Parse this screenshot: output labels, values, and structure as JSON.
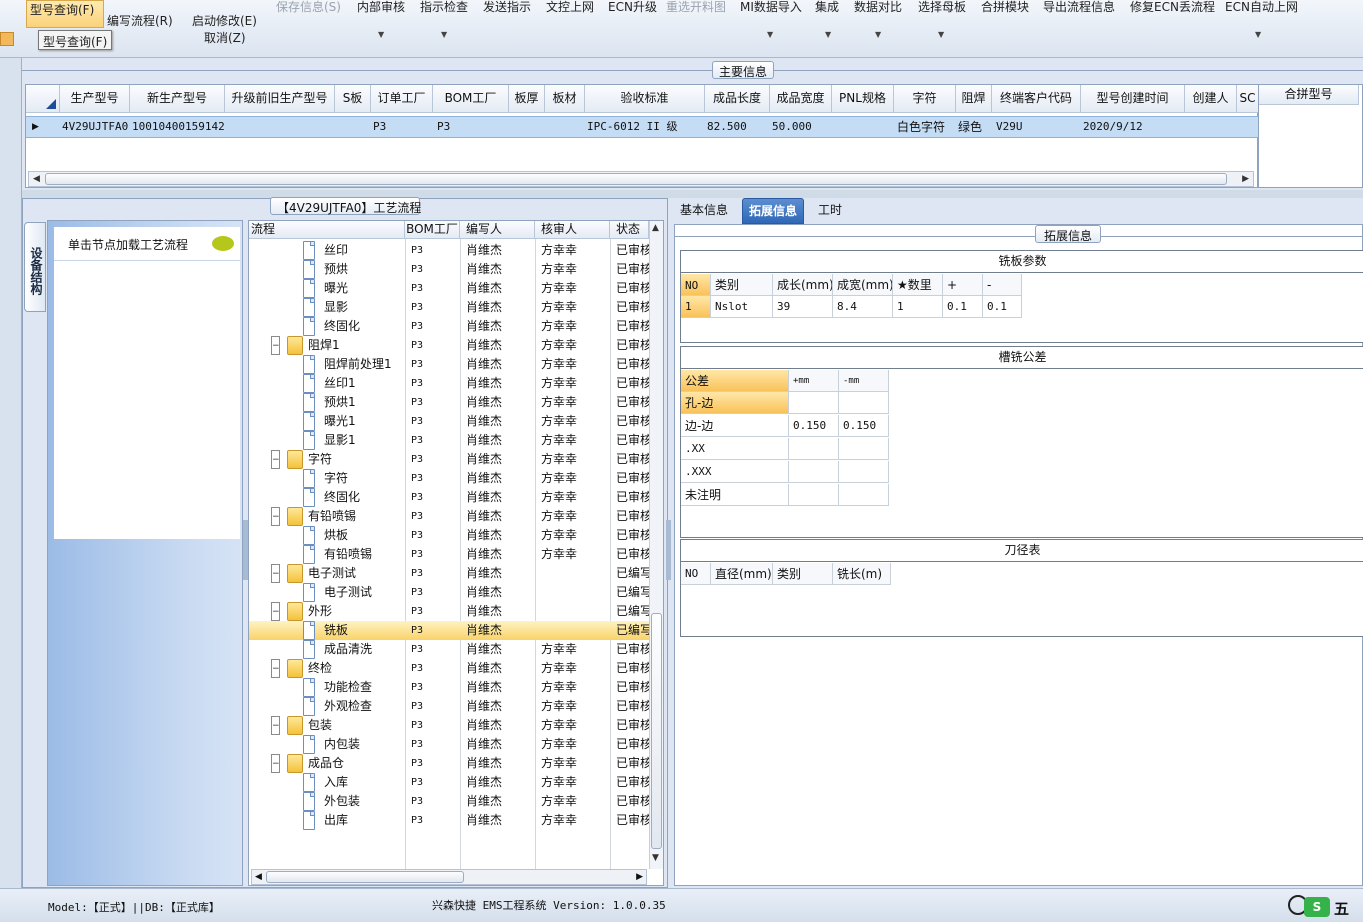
{
  "toolbar": {
    "tooltip": "型号查询(F)",
    "buttons": [
      {
        "label": "型号查询(F)",
        "disabled": false
      },
      {
        "label": "编写流程(R)",
        "disabled": false
      },
      {
        "label": "启动修改(E)",
        "disabled": false
      },
      {
        "label": "取消(Z)",
        "disabled": false
      },
      {
        "label": "保存信息(S)",
        "disabled": true
      },
      {
        "label": "内部审核",
        "disabled": false
      },
      {
        "label": "指示检查",
        "disabled": false
      },
      {
        "label": "发送指示",
        "disabled": false
      },
      {
        "label": "文控上网",
        "disabled": false
      },
      {
        "label": "ECN升级",
        "disabled": false
      },
      {
        "label": "重选开料图",
        "disabled": true
      },
      {
        "label": "MI数据导入",
        "disabled": false
      },
      {
        "label": "集成",
        "disabled": false
      },
      {
        "label": "数据对比",
        "disabled": false
      },
      {
        "label": "选择母板",
        "disabled": false
      },
      {
        "label": "合拼模块",
        "disabled": false
      },
      {
        "label": "导出流程信息",
        "disabled": false
      },
      {
        "label": "修复ECN丢流程",
        "disabled": false
      },
      {
        "label": "ECN自动上网",
        "disabled": false
      }
    ]
  },
  "main_info": {
    "title": "主要信息",
    "columns": [
      "生产型号",
      "新生产型号",
      "升级前旧生产型号",
      "S板",
      "订单工厂",
      "BOM工厂",
      "板厚",
      "板材",
      "验收标准",
      "成品长度",
      "成品宽度",
      "PNL规格",
      "字符",
      "阻焊",
      "终端客户代码",
      "型号创建时间",
      "创建人",
      "SC"
    ],
    "rows": [
      [
        "4V29UJTFA0",
        "10010400159142",
        "",
        "",
        "P3",
        "P3",
        "",
        "",
        "IPC-6012 II 级",
        "82.500",
        "50.000",
        "",
        "白色字符",
        "绿色",
        "V29U",
        "2020/9/12",
        "",
        ""
      ]
    ],
    "side_title": "合拼型号"
  },
  "process": {
    "title": "【4V29UJTFA0】工艺流程",
    "vertical_tab": "设备结构",
    "hint": "单击节点加载工艺流程",
    "columns": [
      "流程",
      "BOM工厂",
      "编写人",
      "核审人",
      "状态"
    ],
    "nodes": [
      {
        "name": "丝印",
        "level": 2,
        "factory": "P3",
        "writer": "肖维杰",
        "reviewer": "方幸幸",
        "status": "已审核"
      },
      {
        "name": "预烘",
        "level": 2,
        "factory": "P3",
        "writer": "肖维杰",
        "reviewer": "方幸幸",
        "status": "已审核"
      },
      {
        "name": "曝光",
        "level": 2,
        "factory": "P3",
        "writer": "肖维杰",
        "reviewer": "方幸幸",
        "status": "已审核"
      },
      {
        "name": "显影",
        "level": 2,
        "factory": "P3",
        "writer": "肖维杰",
        "reviewer": "方幸幸",
        "status": "已审核"
      },
      {
        "name": "终固化",
        "level": 2,
        "factory": "P3",
        "writer": "肖维杰",
        "reviewer": "方幸幸",
        "status": "已审核"
      },
      {
        "name": "阻焊1",
        "level": 1,
        "factory": "P3",
        "writer": "肖维杰",
        "reviewer": "方幸幸",
        "status": "已审核"
      },
      {
        "name": "阻焊前处理1",
        "level": 2,
        "factory": "P3",
        "writer": "肖维杰",
        "reviewer": "方幸幸",
        "status": "已审核"
      },
      {
        "name": "丝印1",
        "level": 2,
        "factory": "P3",
        "writer": "肖维杰",
        "reviewer": "方幸幸",
        "status": "已审核"
      },
      {
        "name": "预烘1",
        "level": 2,
        "factory": "P3",
        "writer": "肖维杰",
        "reviewer": "方幸幸",
        "status": "已审核"
      },
      {
        "name": "曝光1",
        "level": 2,
        "factory": "P3",
        "writer": "肖维杰",
        "reviewer": "方幸幸",
        "status": "已审核"
      },
      {
        "name": "显影1",
        "level": 2,
        "factory": "P3",
        "writer": "肖维杰",
        "reviewer": "方幸幸",
        "status": "已审核"
      },
      {
        "name": "字符",
        "level": 1,
        "factory": "P3",
        "writer": "肖维杰",
        "reviewer": "方幸幸",
        "status": "已审核"
      },
      {
        "name": "字符",
        "level": 2,
        "factory": "P3",
        "writer": "肖维杰",
        "reviewer": "方幸幸",
        "status": "已审核"
      },
      {
        "name": "终固化",
        "level": 2,
        "factory": "P3",
        "writer": "肖维杰",
        "reviewer": "方幸幸",
        "status": "已审核"
      },
      {
        "name": "有铅喷锡",
        "level": 1,
        "factory": "P3",
        "writer": "肖维杰",
        "reviewer": "方幸幸",
        "status": "已审核"
      },
      {
        "name": "烘板",
        "level": 2,
        "factory": "P3",
        "writer": "肖维杰",
        "reviewer": "方幸幸",
        "status": "已审核"
      },
      {
        "name": "有铅喷锡",
        "level": 2,
        "factory": "P3",
        "writer": "肖维杰",
        "reviewer": "方幸幸",
        "status": "已审核"
      },
      {
        "name": "电子测试",
        "level": 1,
        "factory": "P3",
        "writer": "肖维杰",
        "reviewer": "",
        "status": "已编写"
      },
      {
        "name": "电子测试",
        "level": 2,
        "factory": "P3",
        "writer": "肖维杰",
        "reviewer": "",
        "status": "已编写"
      },
      {
        "name": "外形",
        "level": 1,
        "factory": "P3",
        "writer": "肖维杰",
        "reviewer": "",
        "status": "已编写"
      },
      {
        "name": "铣板",
        "level": 2,
        "factory": "P3",
        "writer": "肖维杰",
        "reviewer": "",
        "status": "已编写",
        "selected": true
      },
      {
        "name": "成品清洗",
        "level": 2,
        "factory": "P3",
        "writer": "肖维杰",
        "reviewer": "方幸幸",
        "status": "已审核"
      },
      {
        "name": "终检",
        "level": 1,
        "factory": "P3",
        "writer": "肖维杰",
        "reviewer": "方幸幸",
        "status": "已审核"
      },
      {
        "name": "功能检查",
        "level": 2,
        "factory": "P3",
        "writer": "肖维杰",
        "reviewer": "方幸幸",
        "status": "已审核"
      },
      {
        "name": "外观检查",
        "level": 2,
        "factory": "P3",
        "writer": "肖维杰",
        "reviewer": "方幸幸",
        "status": "已审核"
      },
      {
        "name": "包装",
        "level": 1,
        "factory": "P3",
        "writer": "肖维杰",
        "reviewer": "方幸幸",
        "status": "已审核"
      },
      {
        "name": "内包装",
        "level": 2,
        "factory": "P3",
        "writer": "肖维杰",
        "reviewer": "方幸幸",
        "status": "已审核"
      },
      {
        "name": "成品仓",
        "level": 1,
        "factory": "P3",
        "writer": "肖维杰",
        "reviewer": "方幸幸",
        "status": "已审核"
      },
      {
        "name": "入库",
        "level": 2,
        "factory": "P3",
        "writer": "肖维杰",
        "reviewer": "方幸幸",
        "status": "已审核"
      },
      {
        "name": "外包装",
        "level": 2,
        "factory": "P3",
        "writer": "肖维杰",
        "reviewer": "方幸幸",
        "status": "已审核"
      },
      {
        "name": "出库",
        "level": 2,
        "factory": "P3",
        "writer": "肖维杰",
        "reviewer": "方幸幸",
        "status": "已审核"
      }
    ]
  },
  "detail": {
    "tabs": [
      "基本信息",
      "拓展信息",
      "工时"
    ],
    "active_tab": "拓展信息",
    "group_title": "拓展信息",
    "milling": {
      "title": "铣板参数",
      "columns": [
        "NO",
        "类别",
        "成长(mm)",
        "成宽(mm)",
        "★数里",
        "+",
        "-"
      ],
      "rows": [
        [
          "1",
          "Nslot",
          "39",
          "8.4",
          "1",
          "0.1",
          "0.1"
        ]
      ]
    },
    "tolerance": {
      "title": "槽铣公差",
      "columns": [
        "公差",
        "+mm",
        "-mm"
      ],
      "rows": [
        [
          "孔-边",
          "",
          ""
        ],
        [
          "边-边",
          "0.150",
          "0.150"
        ],
        [
          ".XX",
          "",
          ""
        ],
        [
          ".XXX",
          "",
          ""
        ],
        [
          "未注明",
          "",
          ""
        ]
      ]
    },
    "cutter": {
      "title": "刀径表",
      "columns": [
        "NO",
        "直径(mm)",
        "类别",
        "铣长(m)"
      ]
    }
  },
  "status_bar": {
    "left": "Model:【正式】||DB:【正式库】",
    "center": "兴森快捷  EMS工程系统  Version: 1.0.0.35",
    "ime": "五"
  },
  "colors": {
    "accent": "#2f68b8",
    "selection": "#f9d36a",
    "grid_selected_row": "#c5dcf5"
  }
}
